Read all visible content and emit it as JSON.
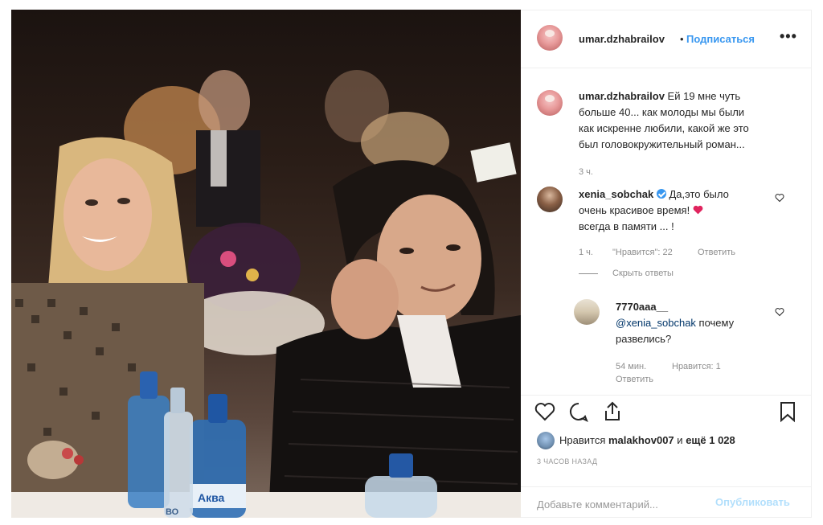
{
  "header": {
    "username": "umar.dzhabrailov",
    "separator": "•",
    "follow_label": "Подписаться",
    "more_label": "•••"
  },
  "caption": {
    "username": "umar.dzhabrailov",
    "line1": "Ей 19 мне чуть",
    "line2": "больше 40... как молоды мы были",
    "line3": "как искренне любили, какой же это",
    "line4": "был головокружительный роман...",
    "time": "3 ч."
  },
  "comments": [
    {
      "username": "xenia_sobchak",
      "verified": true,
      "line1": "Да,это было",
      "line2": "очень красивое время!",
      "line3": "всегда в памяти ... !",
      "time": "1 ч.",
      "likes": "\"Нравится\": 22",
      "reply_label": "Ответить",
      "hide_replies_label": "Скрыть ответы",
      "replies": [
        {
          "username": "7770aaa__",
          "mention": "@xenia_sobchak",
          "line1_rest": " почему",
          "line2": "развелись?",
          "time": "54 мин.",
          "likes": "Нравится: 1",
          "reply_label": "Ответить"
        }
      ]
    }
  ],
  "actions": {
    "like_icon": "heart-outline-icon",
    "comment_icon": "comment-bubble-icon",
    "share_icon": "share-upload-icon",
    "save_icon": "bookmark-icon"
  },
  "likes": {
    "prefix": "Нравится",
    "user": "malakhov007",
    "middle": "и",
    "count": "ещё 1 028"
  },
  "timestamp": "3 часов назад",
  "add_comment": {
    "placeholder": "Добавьте комментарий...",
    "post_label": "Опубликовать"
  },
  "photo": {
    "bottle_labels": [
      "Aква",
      "ВО"
    ]
  },
  "colors": {
    "link_blue": "#3897f0",
    "heart_red": "#e0245e",
    "muted": "#8e8e8e",
    "post_disabled": "#b2dffc"
  }
}
